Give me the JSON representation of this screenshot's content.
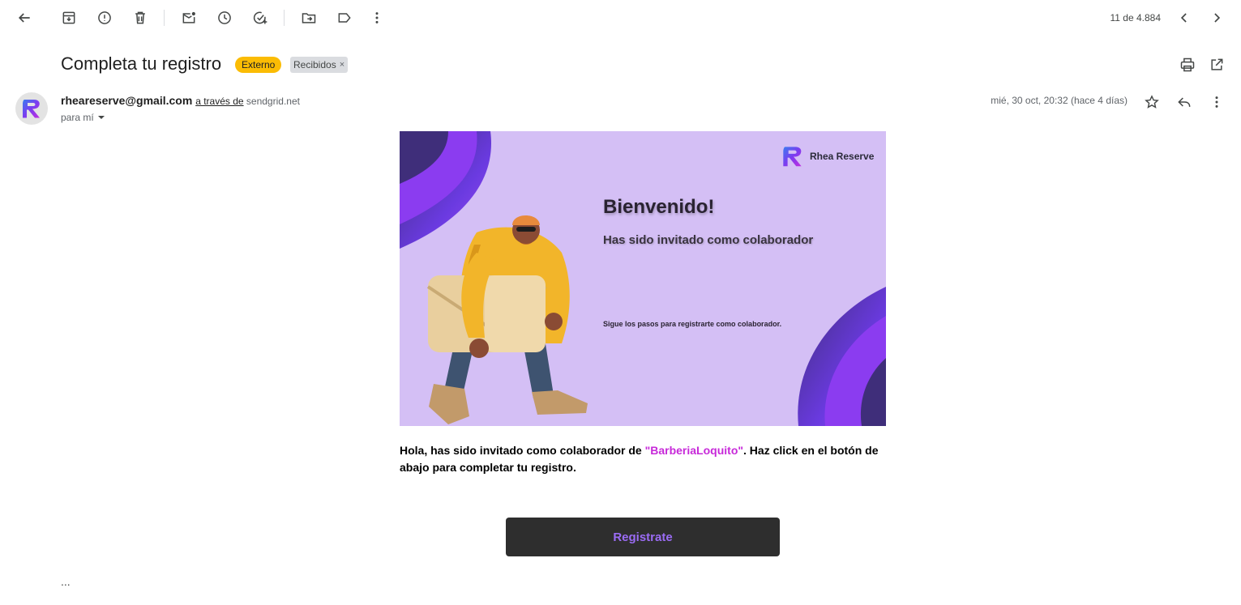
{
  "toolbar": {
    "pager": "11 de 4.884"
  },
  "email": {
    "subject": "Completa tu registro",
    "labels": {
      "external": "Externo",
      "inbox": "Recibidos",
      "inbox_remove": "×"
    },
    "sender": {
      "email": "rheareserve@gmail.com",
      "via_prefix": "a través de",
      "via_domain": "sendgrid.net",
      "to": "para mí"
    },
    "date": "mié, 30 oct, 20:32 (hace 4 días)",
    "banner": {
      "brand": "Rhea Reserve",
      "title": "Bienvenido!",
      "subtitle": "Has sido invitado como colaborador",
      "steps": "Sigue los pasos para registrarte como colaborador."
    },
    "body": {
      "text_before": "Hola, has sido invitado como colaborador de ",
      "highlight": "\"BarberiaLoquito\"",
      "text_after": ". Haz click en el botón de abajo para completar tu registro."
    },
    "cta_label": "Registrate",
    "trimmed": "..."
  },
  "colors": {
    "banner_bg": "#d4bff5",
    "accent_purple": "#8b3cf0",
    "highlight": "#c729d9",
    "cta_bg": "#2e2e2e",
    "cta_text": "#9b6cf5",
    "label_external": "#fbbc04"
  }
}
